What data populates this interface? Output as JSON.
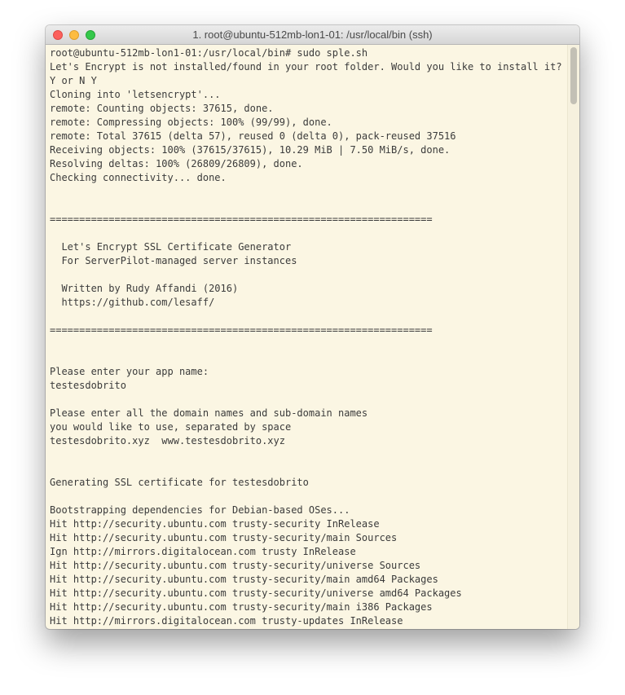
{
  "window": {
    "title": "1. root@ubuntu-512mb-lon1-01: /usr/local/bin (ssh)"
  },
  "terminal": {
    "lines": [
      "root@ubuntu-512mb-lon1-01:/usr/local/bin# sudo sple.sh",
      "Let's Encrypt is not installed/found in your root folder. Would you like to install it?",
      "Y or N Y",
      "Cloning into 'letsencrypt'...",
      "remote: Counting objects: 37615, done.",
      "remote: Compressing objects: 100% (99/99), done.",
      "remote: Total 37615 (delta 57), reused 0 (delta 0), pack-reused 37516",
      "Receiving objects: 100% (37615/37615), 10.29 MiB | 7.50 MiB/s, done.",
      "Resolving deltas: 100% (26809/26809), done.",
      "Checking connectivity... done.",
      "",
      "",
      "=================================================================",
      "",
      "  Let's Encrypt SSL Certificate Generator",
      "  For ServerPilot-managed server instances",
      "",
      "  Written by Rudy Affandi (2016)",
      "  https://github.com/lesaff/",
      "",
      "=================================================================",
      "",
      "",
      "Please enter your app name:",
      "testesdobrito",
      "",
      "Please enter all the domain names and sub-domain names",
      "you would like to use, separated by space",
      "testesdobrito.xyz  www.testesdobrito.xyz",
      "",
      "",
      "Generating SSL certificate for testesdobrito",
      "",
      "Bootstrapping dependencies for Debian-based OSes...",
      "Hit http://security.ubuntu.com trusty-security InRelease",
      "Hit http://security.ubuntu.com trusty-security/main Sources",
      "Ign http://mirrors.digitalocean.com trusty InRelease",
      "Hit http://security.ubuntu.com trusty-security/universe Sources",
      "Hit http://security.ubuntu.com trusty-security/main amd64 Packages",
      "Hit http://security.ubuntu.com trusty-security/universe amd64 Packages",
      "Hit http://security.ubuntu.com trusty-security/main i386 Packages",
      "Hit http://mirrors.digitalocean.com trusty-updates InRelease"
    ]
  },
  "colors": {
    "background": "#fbf6e3",
    "text": "#3b3b3b",
    "close": "#fc605c",
    "minimize": "#fdbc40",
    "zoom": "#34c84a"
  }
}
